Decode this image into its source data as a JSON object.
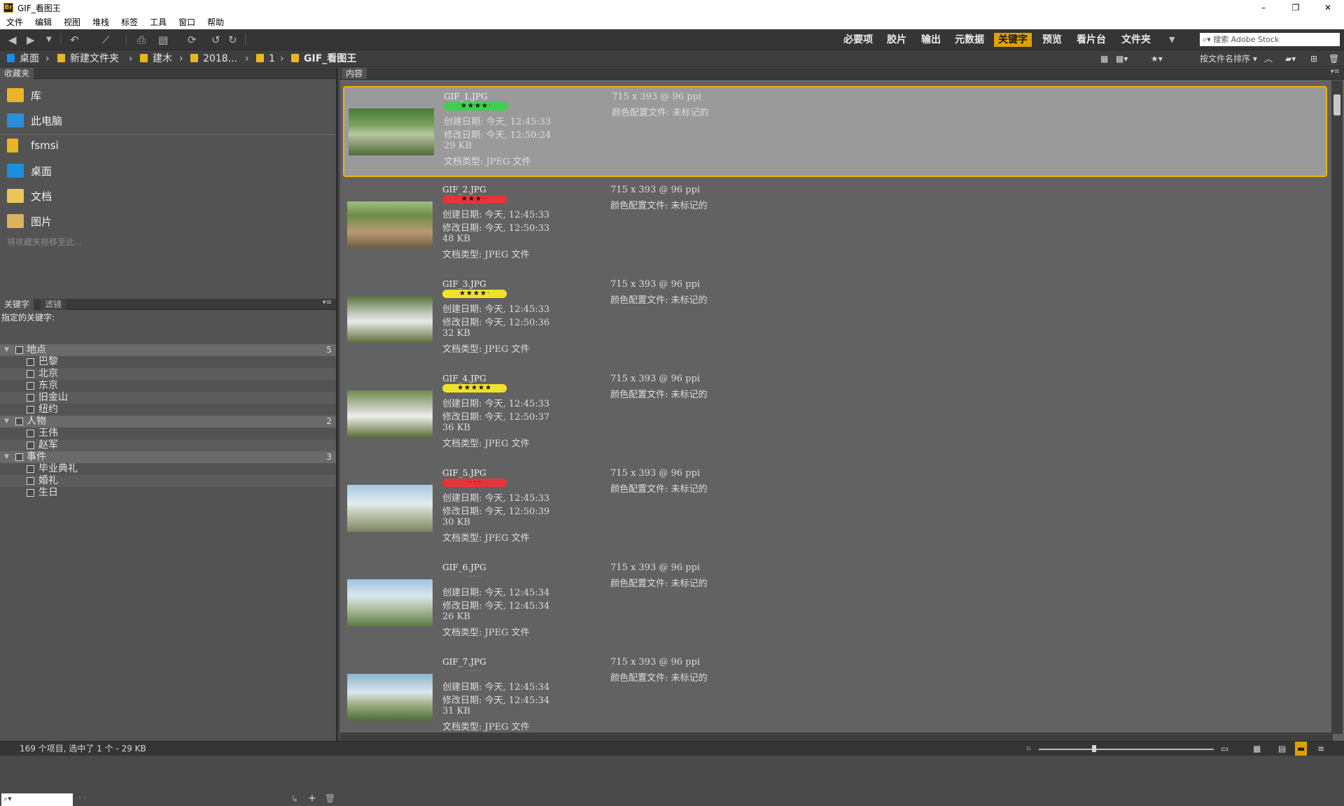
{
  "window": {
    "title": "GIF_看图王",
    "app_icon": "Br",
    "controls": [
      "–",
      "❐",
      "✕"
    ]
  },
  "menu": [
    "文件",
    "编辑",
    "视图",
    "堆栈",
    "标签",
    "工具",
    "窗口",
    "帮助"
  ],
  "workspaces": [
    {
      "label": "必要项",
      "active": false
    },
    {
      "label": "胶片",
      "active": false
    },
    {
      "label": "输出",
      "active": false
    },
    {
      "label": "元数据",
      "active": false
    },
    {
      "label": "关键字",
      "active": true
    },
    {
      "label": "预览",
      "active": false
    },
    {
      "label": "看片台",
      "active": false
    },
    {
      "label": "文件夹",
      "active": false
    }
  ],
  "search": {
    "placeholder": "搜索 Adobe Stock"
  },
  "breadcrumb": [
    "桌面",
    "新建文件夹",
    "建木",
    "2018...",
    "1",
    "GIF_看图王"
  ],
  "sort_label": "按文件名排序",
  "favorites_tab": "收藏夹",
  "favorites": [
    "库",
    "此电脑",
    "fsmsi",
    "桌面",
    "文档",
    "图片"
  ],
  "favorites_hint": "将收藏夹拖移至此...",
  "keyword_tabs": [
    "关键字",
    "滤镜"
  ],
  "keywords_header": "指定的关键字:",
  "keyword_groups": [
    {
      "name": "地点",
      "count": "5",
      "items": [
        "巴黎",
        "北京",
        "东京",
        "旧金山",
        "纽约"
      ]
    },
    {
      "name": "人物",
      "count": "2",
      "items": [
        "王伟",
        "赵军"
      ]
    },
    {
      "name": "事件",
      "count": "3",
      "items": [
        "毕业典礼",
        "婚礼",
        "生日"
      ]
    }
  ],
  "content_tab": "内容",
  "files": [
    {
      "name": "GIF_1.JPG",
      "rating": "★★★★·",
      "label_color": "#3fcf4f",
      "created": "创建日期: 今天, 12:45:33",
      "modified": "修改日期: 今天, 12:50:24",
      "size": "29 KB",
      "type": "文档类型: JPEG 文件",
      "dims": "715 x 393 @ 96 ppi",
      "profile": "颜色配置文件: 未标记的",
      "selected": true
    },
    {
      "name": "GIF_2.JPG",
      "rating": "★★★··",
      "label_color": "#e8333a",
      "created": "创建日期: 今天, 12:45:33",
      "modified": "修改日期: 今天, 12:50:33",
      "size": "48 KB",
      "type": "文档类型: JPEG 文件",
      "dims": "715 x 393 @ 96 ppi",
      "profile": "颜色配置文件: 未标记的",
      "selected": false
    },
    {
      "name": "GIF_3.JPG",
      "rating": "★★★★·",
      "label_color": "#f0e22a",
      "created": "创建日期: 今天, 12:45:33",
      "modified": "修改日期: 今天, 12:50:36",
      "size": "32 KB",
      "type": "文档类型: JPEG 文件",
      "dims": "715 x 393 @ 96 ppi",
      "profile": "颜色配置文件: 未标记的",
      "selected": false
    },
    {
      "name": "GIF_4.JPG",
      "rating": "★★★★★",
      "label_color": "#f0e22a",
      "created": "创建日期: 今天, 12:45:33",
      "modified": "修改日期: 今天, 12:50:37",
      "size": "36 KB",
      "type": "文档类型: JPEG 文件",
      "dims": "715 x 393 @ 96 ppi",
      "profile": "颜色配置文件: 未标记的",
      "selected": false
    },
    {
      "name": "GIF_5.JPG",
      "rating": "·····",
      "label_color": "#e8333a",
      "created": "创建日期: 今天, 12:45:33",
      "modified": "修改日期: 今天, 12:50:39",
      "size": "30 KB",
      "type": "文档类型: JPEG 文件",
      "dims": "715 x 393 @ 96 ppi",
      "profile": "颜色配置文件: 未标记的",
      "selected": false
    },
    {
      "name": "GIF_6.JPG",
      "rating": "·····",
      "label_color": "",
      "created": "创建日期: 今天, 12:45:34",
      "modified": "修改日期: 今天, 12:45:34",
      "size": "26 KB",
      "type": "文档类型: JPEG 文件",
      "dims": "715 x 393 @ 96 ppi",
      "profile": "颜色配置文件: 未标记的",
      "selected": false
    },
    {
      "name": "GIF_7.JPG",
      "rating": "·····",
      "label_color": "",
      "created": "创建日期: 今天, 12:45:34",
      "modified": "修改日期: 今天, 12:45:34",
      "size": "31 KB",
      "type": "文档类型: JPEG 文件",
      "dims": "715 x 393 @ 96 ppi",
      "profile": "颜色配置文件: 未标记的",
      "selected": false
    }
  ],
  "status": "169 个项目, 选中了 1 个 - 29 KB",
  "colors": {
    "accent": "#e0a000",
    "selection_border": "#f0b400",
    "title_bg": "#ffffff"
  }
}
